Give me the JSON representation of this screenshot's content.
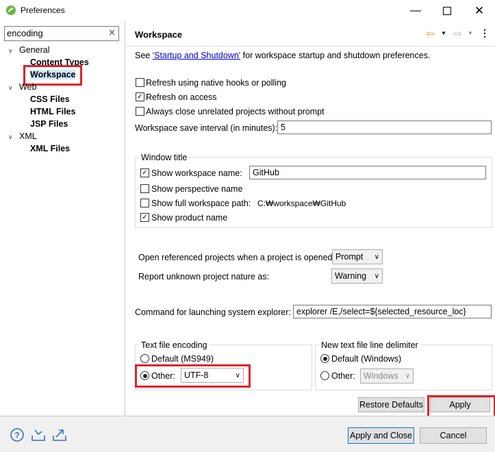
{
  "window": {
    "title": "Preferences",
    "minimize_icon": "minimize-icon",
    "maximize_icon": "maximize-icon",
    "close_icon": "close-icon"
  },
  "filter": {
    "value": "encoding"
  },
  "tree": {
    "general": "General",
    "content_types": "Content Types",
    "workspace": "Workspace",
    "web": "Web",
    "css_files": "CSS Files",
    "html_files": "HTML Files",
    "jsp_files": "JSP Files",
    "xml": "XML",
    "xml_files": "XML Files"
  },
  "page": {
    "title": "Workspace",
    "see_prefix": "See ",
    "see_link": "'Startup and Shutdown'",
    "see_suffix": " for workspace startup and shutdown preferences.",
    "refresh_native": "Refresh using native hooks or polling",
    "refresh_access": "Refresh on access",
    "always_close": "Always close unrelated projects without prompt",
    "save_interval_label": "Workspace save interval (in minutes):",
    "save_interval_value": "5",
    "window_title_group": "Window title",
    "show_ws_name": "Show workspace name:",
    "ws_name_value": "GitHub",
    "show_perspective": "Show perspective name",
    "show_full_path": "Show full workspace path:",
    "full_path_value": "C:₩workspace₩GitHub",
    "show_product": "Show product name",
    "open_ref_label": "Open referenced projects when a project is opened:",
    "open_ref_value": "Prompt",
    "report_label": "Report unknown project nature as:",
    "report_value": "Warning",
    "cmd_label": "Command for launching system explorer:",
    "cmd_value": "explorer /E,/select=${selected_resource_loc}",
    "encoding_group": "Text file encoding",
    "enc_default": "Default (MS949)",
    "enc_other": "Other:",
    "enc_other_value": "UTF-8",
    "delim_group": "New text file line delimiter",
    "delim_default": "Default (Windows)",
    "delim_other": "Other:",
    "delim_other_value": "Windows",
    "restore_defaults": "Restore Defaults",
    "apply": "Apply"
  },
  "footer": {
    "apply_close": "Apply and Close",
    "cancel": "Cancel"
  },
  "colors": {
    "highlight": "#e0202a",
    "link": "#0000cc",
    "accent": "#0078d7"
  }
}
